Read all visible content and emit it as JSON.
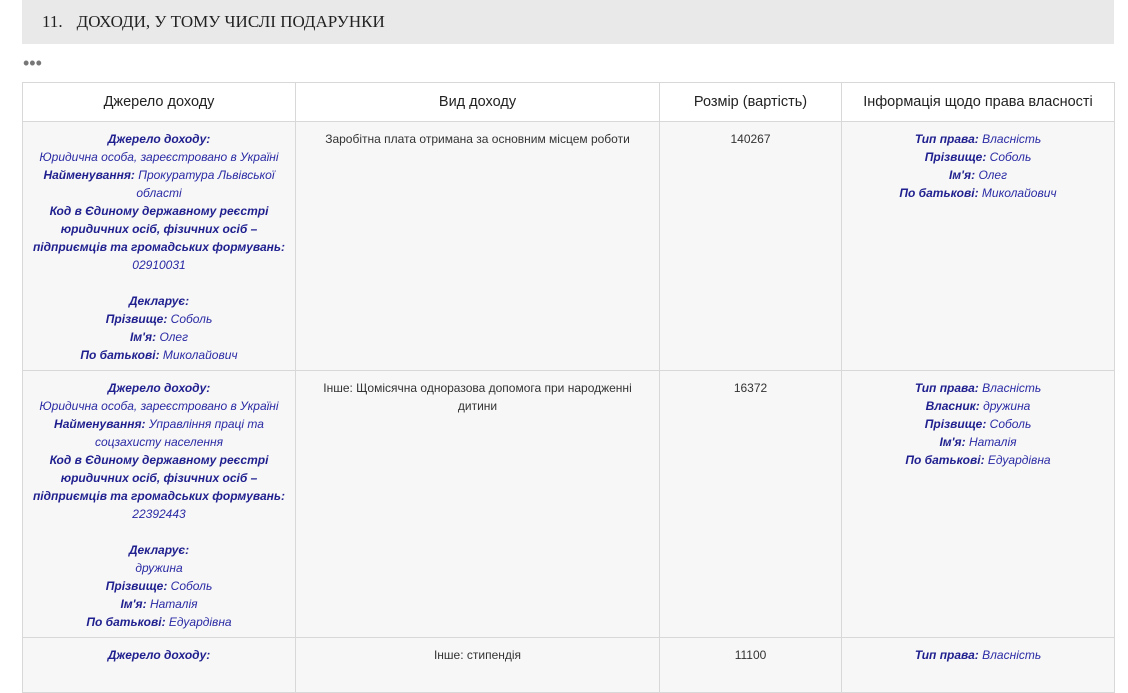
{
  "section": {
    "number": "11.",
    "title": "ДОХОДИ, У ТОМУ ЧИСЛІ ПОДАРУНКИ"
  },
  "more_icon": "•••",
  "table": {
    "headers": [
      "Джерело доходу",
      "Вид доходу",
      "Розмір (вартість)",
      "Інформація щодо права власності"
    ],
    "labels": {
      "source": "Джерело доходу:",
      "name": "Найменування:",
      "code": "Код в Єдиному державному реєстрі юридичних осіб, фізичних осіб – підприємців та громадських формувань:",
      "declarant": "Декларує:",
      "surname": "Прізвище:",
      "first_name": "Ім'я:",
      "patronymic": "По батькові:",
      "right_type": "Тип права:",
      "owner": "Власник:"
    },
    "rows": [
      {
        "source_type": "Юридична особа, зареєстровано в Україні",
        "name": "Прокуратура Львівської області",
        "code": "02910031",
        "declarant": "",
        "surname": "Соболь",
        "first_name": "Олег",
        "patronymic": "Миколайович",
        "income_type": "Заробітна плата отримана за основним місцем роботи",
        "amount": "140267",
        "right_type": "Власність",
        "owner": "",
        "owner_surname": "Соболь",
        "owner_first_name": "Олег",
        "owner_patronymic": "Миколайович"
      },
      {
        "source_type": "Юридична особа, зареєстровано в Україні",
        "name": "Управління праці та соцзахисту населення",
        "code": "22392443",
        "declarant": "дружина",
        "surname": "Соболь",
        "first_name": "Наталія",
        "patronymic": "Едуардівна",
        "income_type": "Інше: Щомісячна одноразова допомога при народженні дитини",
        "amount": "16372",
        "right_type": "Власність",
        "owner": "дружина",
        "owner_surname": "Соболь",
        "owner_first_name": "Наталія",
        "owner_patronymic": "Едуардівна"
      },
      {
        "source_label_only": "Джерело доходу:",
        "income_type": "Інше: стипендія",
        "amount": "11100",
        "right_type": "Власність"
      }
    ]
  }
}
